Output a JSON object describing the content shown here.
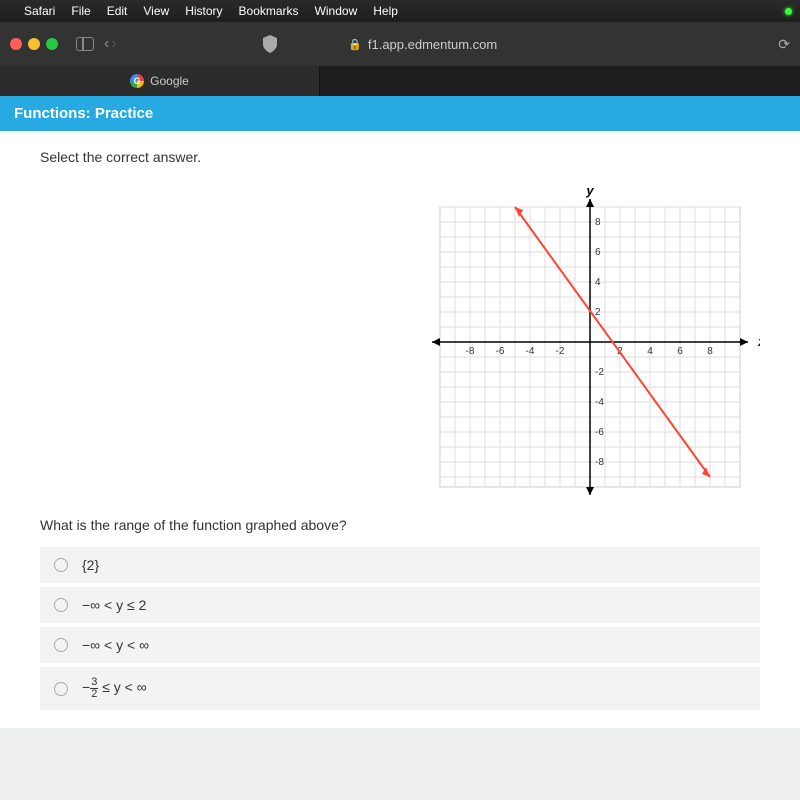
{
  "menu": {
    "app": "Safari",
    "items": [
      "File",
      "Edit",
      "View",
      "History",
      "Bookmarks",
      "Window",
      "Help"
    ]
  },
  "browser": {
    "url": "f1.app.edmentum.com",
    "tab_title": "Google"
  },
  "page_header": "Functions: Practice",
  "instruction": "Select the correct answer.",
  "graph": {
    "y_label": "y",
    "x_label": "x",
    "x_ticks": [
      "-8",
      "-6",
      "-4",
      "-2",
      "2",
      "4",
      "6",
      "8"
    ],
    "y_ticks": [
      "8",
      "6",
      "4",
      "2",
      "-2",
      "-4",
      "-6",
      "-8"
    ]
  },
  "question": "What is the range of the function graphed above?",
  "answers": [
    {
      "label": "{2}"
    },
    {
      "label": "−∞ < y ≤ 2"
    },
    {
      "label": "−∞ < y < ∞"
    },
    {
      "label_html": "frac"
    }
  ],
  "frac_answer": {
    "prefix": "−",
    "num": "3",
    "den": "2",
    "suffix": " ≤ y < ∞"
  },
  "chart_data": {
    "type": "line",
    "title": "",
    "xlabel": "x",
    "ylabel": "y",
    "xlim": [
      -9,
      9
    ],
    "ylim": [
      -9,
      9
    ],
    "series": [
      {
        "name": "line",
        "points": [
          [
            -5,
            9
          ],
          [
            8,
            -9
          ]
        ]
      }
    ],
    "note": "Linear function with negative slope and arrowheads at both ends, passing approximately through (-5,9), (0,2), (8,-9). Line continues in both directions (open rays)."
  }
}
